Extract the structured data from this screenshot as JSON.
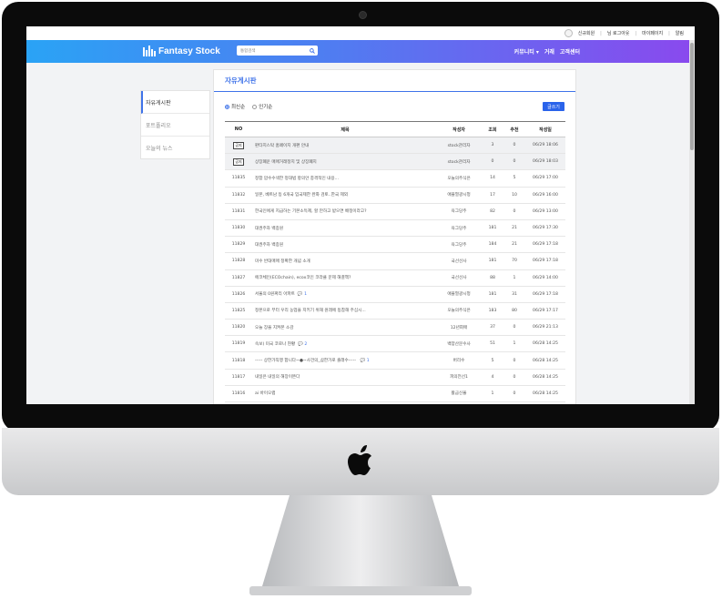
{
  "topbar": {
    "links": [
      "신규회원",
      "님 로그아웃",
      "마이페이지",
      "알림"
    ]
  },
  "nav": {
    "logo_text": "Fantasy Stock",
    "search_placeholder": "통합검색",
    "links": [
      "커뮤니티 ▾",
      "거래",
      "고객센터"
    ]
  },
  "sidebar": {
    "items": [
      {
        "label": "자유게시판",
        "active": true
      },
      {
        "label": "포트폴리오",
        "active": false
      },
      {
        "label": "오늘의 뉴스",
        "active": false
      }
    ]
  },
  "board": {
    "title": "자유게시판",
    "sort_options": [
      {
        "label": "최신순",
        "selected": true
      },
      {
        "label": "인기순",
        "selected": false
      }
    ],
    "write_button": "글쓰기",
    "columns": [
      "NO",
      "제목",
      "작성자",
      "조회",
      "추천",
      "작성일"
    ],
    "notice_badge": "공지",
    "rows": [
      {
        "no": "",
        "notice": true,
        "title": "판타지스탁 홈페이지 개편 안내",
        "comments": "",
        "author": "stock관리자",
        "views": "3",
        "recs": "0",
        "date": "06/29 18:06"
      },
      {
        "no": "",
        "notice": true,
        "title": "상장폐운 매매거래정지 및 상장폐지",
        "comments": "",
        "author": "stock관리자",
        "views": "0",
        "recs": "0",
        "date": "06/29 18:03"
      },
      {
        "no": "11835",
        "notice": false,
        "title": "정합 압수수색한 정대법 항의안 충격적인 내용...",
        "comments": "",
        "author": "오늘의주식은",
        "views": "14",
        "recs": "5",
        "date": "06/29 17:00"
      },
      {
        "no": "11832",
        "notice": false,
        "title": "일본, 베트남 등 6개국 입국제한 완화 검토..한국 제외",
        "comments": "",
        "author": "애플열광시청",
        "views": "17",
        "recs": "10",
        "date": "06/29 16:00"
      },
      {
        "no": "11831",
        "notice": false,
        "title": "한국인에게 지급하는 기본소득제, 할 만하고 받으면 배정이라고?",
        "comments": "",
        "author": "육그당주",
        "views": "82",
        "recs": "0",
        "date": "06/29 13:00"
      },
      {
        "no": "11830",
        "notice": false,
        "title": "대권주자 백종원",
        "comments": "",
        "author": "육그당주",
        "views": "181",
        "recs": "21",
        "date": "06/29 17:30"
      },
      {
        "no": "11829",
        "notice": false,
        "title": "대권주자 백종원",
        "comments": "",
        "author": "육그당주",
        "views": "184",
        "recs": "21",
        "date": "06/29 17:18"
      },
      {
        "no": "11828",
        "notice": false,
        "title": "미수 반대매매 정확한 개념 소개",
        "comments": "",
        "author": "국선선사",
        "views": "181",
        "recs": "70",
        "date": "06/29 17:18"
      },
      {
        "no": "11827",
        "notice": false,
        "title": "에코체인(ECOchain), ecox코인 코라클 문제 해결책?",
        "comments": "",
        "author": "국선선사",
        "views": "88",
        "recs": "1",
        "date": "06/29 14:00"
      },
      {
        "no": "11826",
        "notice": false,
        "title": "서울의 0원짜리 아파트",
        "comments": "1",
        "author": "애플열광시청",
        "views": "181",
        "recs": "31",
        "date": "06/29 17:18"
      },
      {
        "no": "11825",
        "notice": false,
        "title": "정본으로 부터 우리 농업을 지키기 위해 원래에 동참해 주십시...",
        "comments": "",
        "author": "오늘의주식은",
        "views": "183",
        "recs": "80",
        "date": "06/29 17:17"
      },
      {
        "no": "11820",
        "notice": false,
        "title": "오늘 장을 지켜본 소감",
        "comments": "",
        "author": "12년회매",
        "views": "37",
        "recs": "0",
        "date": "06/29 21:13"
      },
      {
        "no": "11819",
        "notice": false,
        "title": "속보) 미국 코로나 현황",
        "comments": "2",
        "author": "백양산문수사",
        "views": "51",
        "recs": "1",
        "date": "06/28 14:25"
      },
      {
        "no": "11818",
        "notice": false,
        "title": "----- 상한가직행 합니다~●~사건의_삼한가로 출래수----- ",
        "comments": "1",
        "author": "버리수",
        "views": "5",
        "recs": "0",
        "date": "06/28 14:25"
      },
      {
        "no": "11817",
        "notice": false,
        "title": "내일은 내일의 해장이뜬다",
        "comments": "",
        "author": "피의전선1",
        "views": "4",
        "recs": "0",
        "date": "06/28 14:25"
      },
      {
        "no": "11816",
        "notice": false,
        "title": "ai 바이오랩",
        "comments": "",
        "author": "활금신율",
        "views": "1",
        "recs": "0",
        "date": "06/28 14:25"
      },
      {
        "no": "11815",
        "notice": false,
        "title": "<<<긴급진찰>>> 오늘 미국장 예측--!!",
        "comments": "",
        "author": "신선허름",
        "views": "3",
        "recs": "0",
        "date": "06/28 14:25"
      },
      {
        "no": "11814",
        "notice": false,
        "title": "●●(시뮤드1주●●폐지열병+미중무역전쟁 최대수혜주●●",
        "comments": "",
        "author": "Caribou",
        "views": "3",
        "recs": "1",
        "date": "06/28 14:25"
      },
      {
        "no": "11813",
        "notice": false,
        "title": "●●(시뮤드1주●●폐지열병+미중무역전쟁 최대수혜주●●",
        "comments": "",
        "author": "Caribou",
        "views": "3",
        "recs": "1",
        "date": "06/28 14:25"
      }
    ]
  }
}
